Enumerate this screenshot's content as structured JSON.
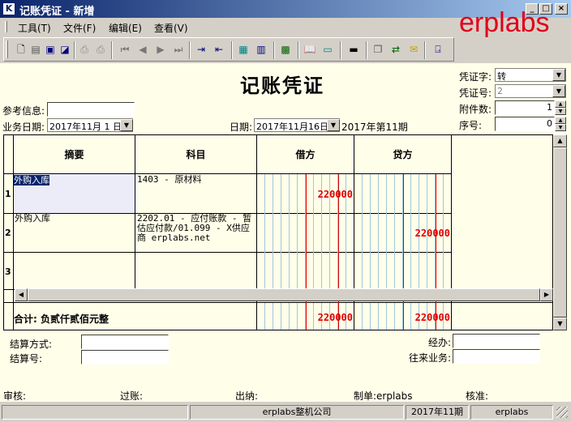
{
  "window": {
    "title": "记账凭证 - 新增",
    "app_icon": "K",
    "min": "_",
    "max": "□",
    "close": "×"
  },
  "brand": "erplabs",
  "menu": [
    "工具(T)",
    "文件(F)",
    "编辑(E)",
    "查看(V)"
  ],
  "toolbar_icons": [
    "new-icon",
    "open-icon",
    "save-icon",
    "save-as-icon",
    "print-preview-icon",
    "print-icon",
    "first-icon",
    "prev-icon",
    "next-icon",
    "last-icon",
    "insert-row-icon",
    "delete-row-icon",
    "calculator-icon",
    "book-icon",
    "grid-icon",
    "help-book-icon",
    "monitor-icon",
    "flag-icon",
    "copy-icon",
    "exchange-icon",
    "mail-icon",
    "exit-icon"
  ],
  "voucher": {
    "title": "记账凭证",
    "ref_label": "参考信息:",
    "ref_value": "",
    "bizdate_label": "业务日期:",
    "bizdate_value": "2017年11月 1 日",
    "date_label": "日期:",
    "date_value": "2017年11月16日",
    "period": "2017年第11期",
    "type_label": "凭证字:",
    "type_value": "转",
    "no_label": "凭证号:",
    "no_value": "2",
    "attach_label": "附件数:",
    "attach_value": "1",
    "seq_label": "序号:",
    "seq_value": "0"
  },
  "grid": {
    "headers": {
      "summary": "摘要",
      "account": "科目",
      "debit": "借方",
      "credit": "贷方"
    },
    "rows": [
      {
        "no": "1",
        "summary": "外购入库",
        "account": "1403 - 原材料",
        "debit": "220000",
        "credit": ""
      },
      {
        "no": "2",
        "summary": "外购入库",
        "account": "2202.01 - 应付账款 - 暂估应付款/01.099 - X供应商 erplabs.net",
        "debit": "",
        "credit": "220000"
      },
      {
        "no": "3",
        "summary": "",
        "account": "",
        "debit": "",
        "credit": ""
      }
    ],
    "total_label": "合计: 负贰仟贰佰元整",
    "total_debit": "220000",
    "total_credit": "220000"
  },
  "bottom": {
    "settle_method_label": "结算方式:",
    "settle_no_label": "结算号:",
    "handler_label": "经办:",
    "business_label": "往来业务:"
  },
  "signatures": {
    "audit": "审核:",
    "post": "过账:",
    "cashier": "出纳:",
    "maker": "制单:erplabs",
    "approve": "核准:"
  },
  "status": {
    "company": "erplabs整机公司",
    "period": "2017年11期",
    "user": "erplabs"
  }
}
